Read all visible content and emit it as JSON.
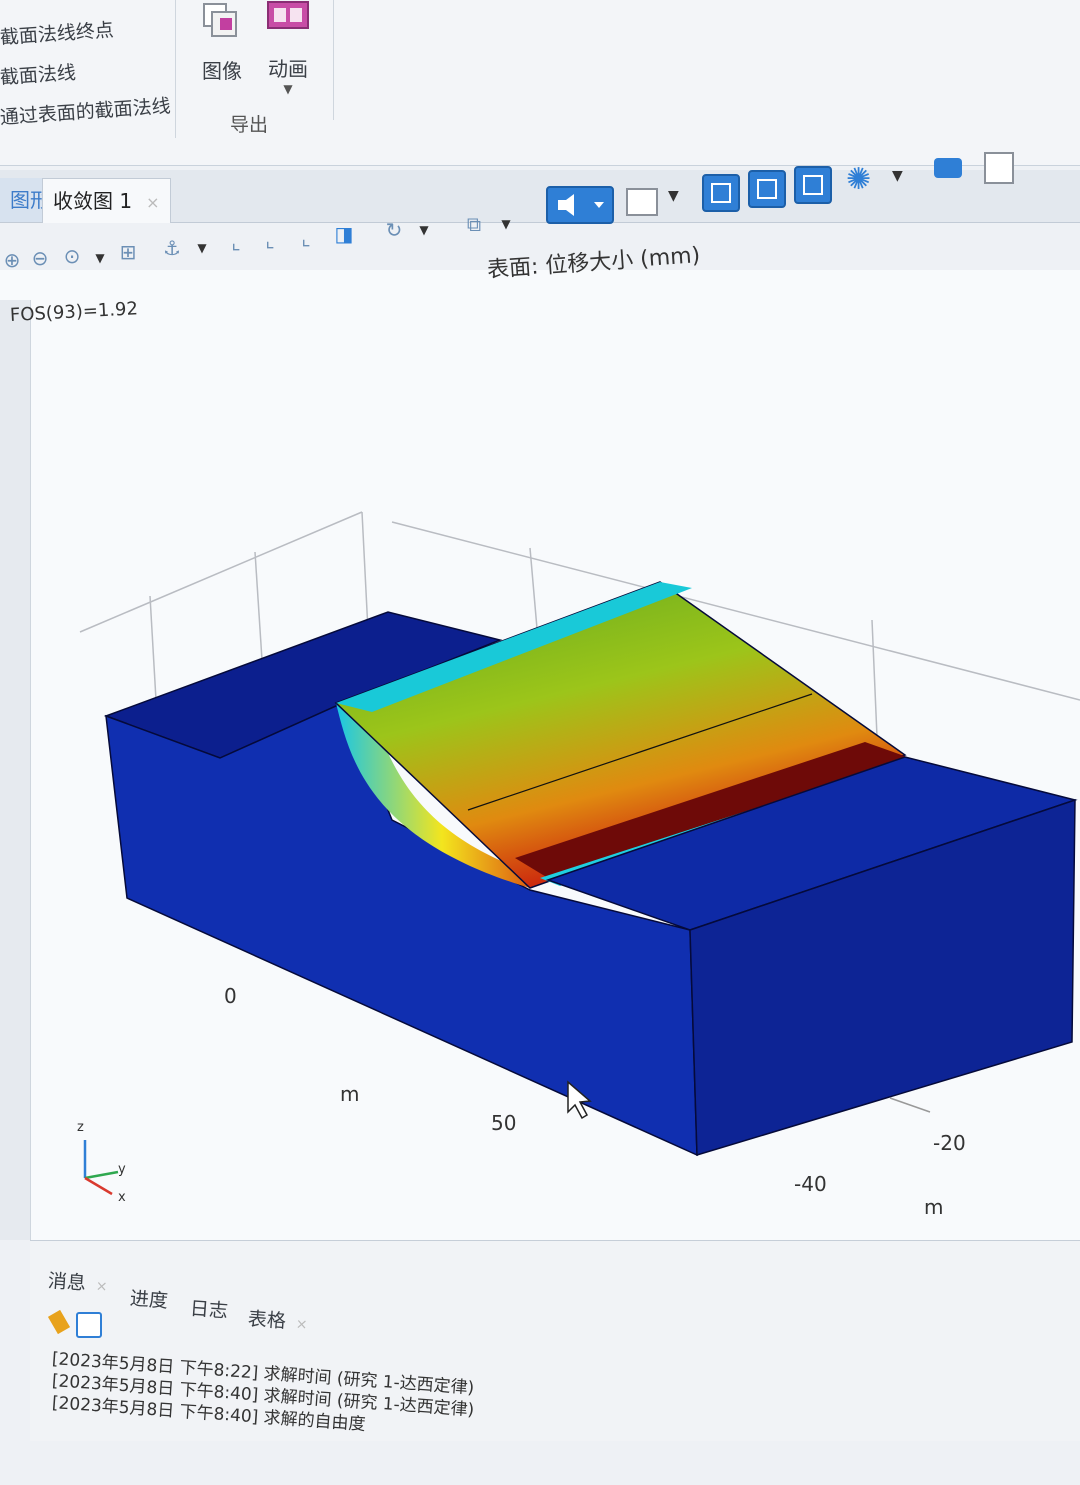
{
  "ribbon": {
    "items": [
      "截面法线终点",
      "截面法线",
      "通过表面的截面法线"
    ],
    "buttons": {
      "image": "图像",
      "animation": "动画"
    },
    "group_label": "导出"
  },
  "tabs": [
    {
      "label": "图形"
    },
    {
      "label": "收敛图 1",
      "close": "×"
    }
  ],
  "plot": {
    "title": "表面: 位移大小 (mm)",
    "annotation": "FOS(93)=1.92",
    "axis_ticks": {
      "x0": "0",
      "x50": "50",
      "y_neg20": "-20",
      "y_neg40": "-40"
    },
    "axis_units": {
      "x": "m",
      "y": "m"
    },
    "triad": {
      "z": "z",
      "y": "y",
      "x": "x"
    }
  },
  "messages": {
    "tabs": [
      {
        "label": "消息",
        "close": "×"
      },
      {
        "label": "进度"
      },
      {
        "label": "日志"
      },
      {
        "label": "表格",
        "close": "×"
      }
    ],
    "lines": [
      "[2023年5月8日 下午8:22] 求解时间 (研究 1-达西定律)",
      "[2023年5月8日 下午8:40] 求解时间 (研究 1-达西定律)",
      "[2023年5月8日 下午8:40] 求解的自由度"
    ]
  },
  "colors": {
    "accent": "#2f7fd6",
    "block": "#0e2aa6",
    "slope_hot": "#c8150e",
    "slope_mid": "#7fbf1f"
  }
}
